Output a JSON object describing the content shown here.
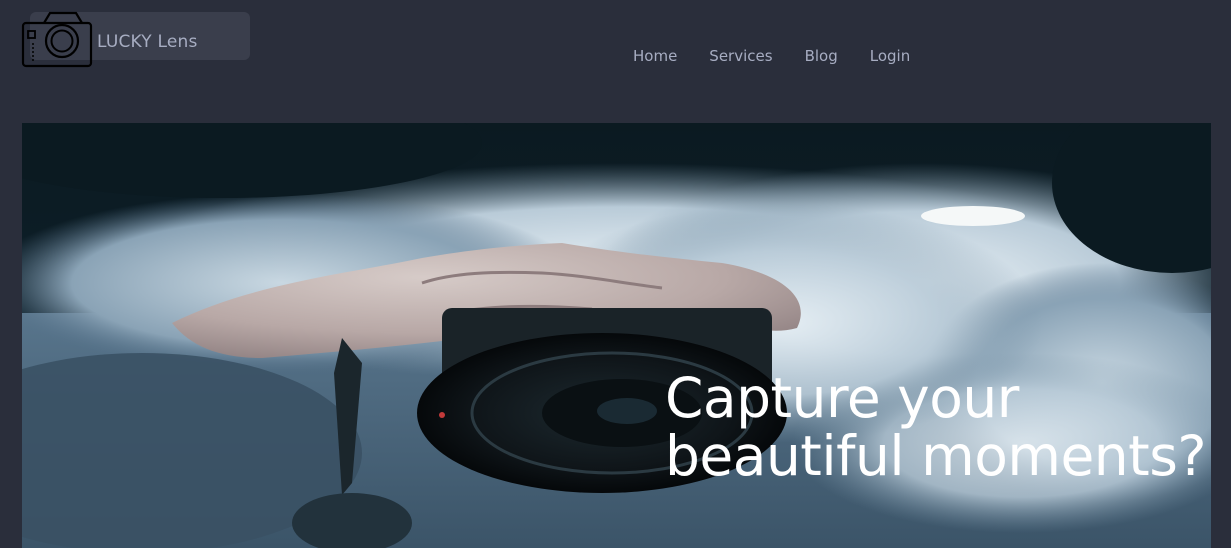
{
  "brand": {
    "name": "LUCKY Lens",
    "logo_icon": "camera-icon"
  },
  "nav": {
    "items": [
      {
        "label": "Home"
      },
      {
        "label": "Services"
      },
      {
        "label": "Blog"
      },
      {
        "label": "Login"
      }
    ]
  },
  "hero": {
    "title_line1": "Capture your",
    "title_line2": "beautiful moments?",
    "image": "hand-holding-camera-in-clouds"
  },
  "colors": {
    "page_background": "#2a2e3b",
    "brand_box": "#3a3e4c",
    "nav_text": "#a7adc2",
    "hero_text": "#ffffff"
  }
}
